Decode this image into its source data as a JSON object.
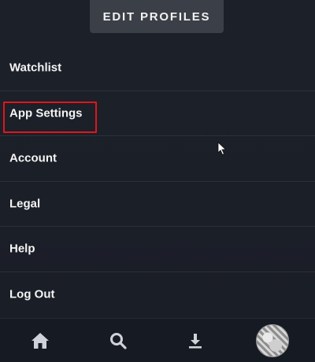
{
  "header": {
    "edit_profiles_label": "EDIT PROFILES"
  },
  "menu": {
    "items": [
      {
        "label": "Watchlist"
      },
      {
        "label": "App Settings",
        "highlighted": true
      },
      {
        "label": "Account"
      },
      {
        "label": "Legal"
      },
      {
        "label": "Help"
      },
      {
        "label": "Log Out"
      }
    ]
  },
  "tabbar": {
    "tabs": [
      {
        "icon": "home-icon"
      },
      {
        "icon": "search-icon"
      },
      {
        "icon": "download-icon"
      },
      {
        "icon": "profile-avatar"
      }
    ]
  },
  "colors": {
    "background": "#1b1f28",
    "highlight_border": "#e0161e",
    "text": "#f4f4f4"
  }
}
